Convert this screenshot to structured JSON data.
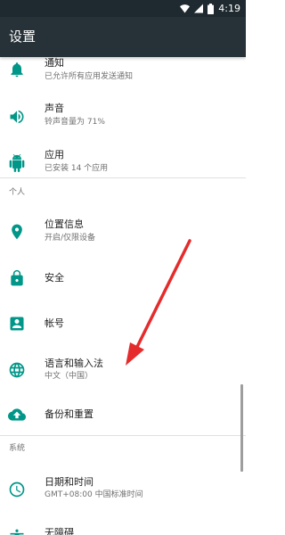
{
  "status_bar": {
    "time": "4:19"
  },
  "app_bar": {
    "title": "设置"
  },
  "items": {
    "notifications": {
      "title": "通知",
      "subtitle": "已允许所有应用发送通知",
      "icon": "bell-icon"
    },
    "sound": {
      "title": "声音",
      "subtitle": "铃声音量为 71%",
      "icon": "volume-icon"
    },
    "apps": {
      "title": "应用",
      "subtitle": "已安装 14 个应用",
      "icon": "android-icon"
    },
    "location": {
      "title": "位置信息",
      "subtitle": "开启/仅限设备",
      "icon": "location-pin-icon"
    },
    "security": {
      "title": "安全",
      "icon": "lock-icon"
    },
    "accounts": {
      "title": "帐号",
      "icon": "account-box-icon"
    },
    "language": {
      "title": "语言和输入法",
      "subtitle": "中文（中国）",
      "icon": "globe-icon"
    },
    "backup": {
      "title": "备份和重置",
      "icon": "cloud-upload-icon"
    },
    "date_time": {
      "title": "日期和时间",
      "subtitle": "GMT+08:00 中国标准时间",
      "icon": "clock-icon"
    },
    "accessibility": {
      "title": "无障碍",
      "icon": "accessibility-icon"
    }
  },
  "sections": {
    "personal": "个人",
    "system": "系统"
  },
  "colors": {
    "accent": "#009688",
    "app_bar": "#263238",
    "status_bar": "#1f2a30",
    "annotation_arrow": "#e52b2b"
  }
}
